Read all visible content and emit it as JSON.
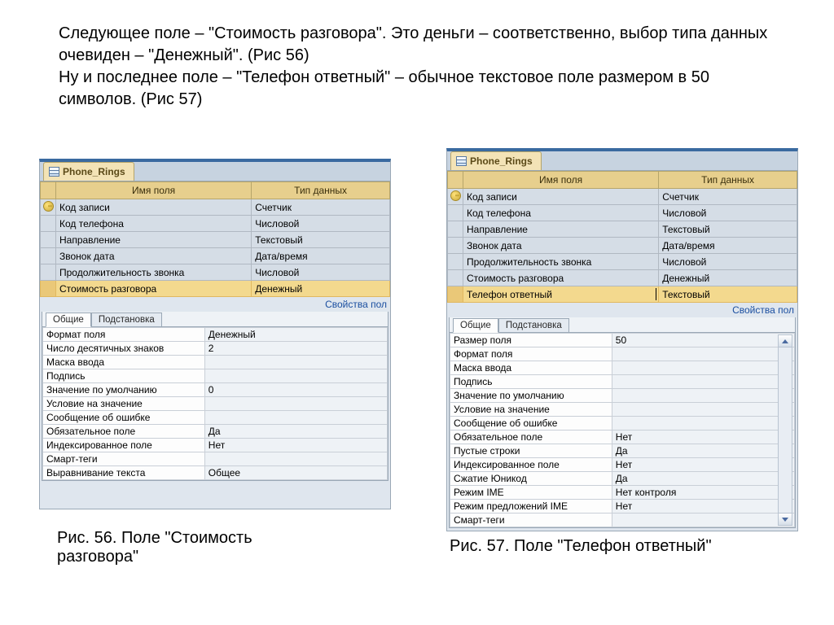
{
  "intro": {
    "p1_a": "Следующее поле – \"Стоимость разговора\". Это деньги – соответственно, выбор типа данных очевиден – \"Денежный\". (Рис 56)",
    "p2_a": "Ну и последнее поле – \"Телефон ответный\" – обычное текстовое поле размером в 50 символов. (Рис 57)"
  },
  "common": {
    "table_tab": "Phone_Rings",
    "col_name": "Имя поля",
    "col_type": "Тип данных",
    "propbar": "Свойства пол",
    "tab_general": "Общие",
    "tab_lookup": "Подстановка"
  },
  "fig56": {
    "rows": [
      {
        "name": "Код записи",
        "type": "Счетчик",
        "pk": true
      },
      {
        "name": "Код телефона",
        "type": "Числовой"
      },
      {
        "name": "Направление",
        "type": "Текстовый"
      },
      {
        "name": "Звонок дата",
        "type": "Дата/время"
      },
      {
        "name": "Продолжительность звонка",
        "type": "Числовой"
      },
      {
        "name": "Стоимость разговора",
        "type": "Денежный",
        "sel": true
      }
    ],
    "props": [
      {
        "label": "Формат поля",
        "value": "Денежный"
      },
      {
        "label": "Число десятичных знаков",
        "value": "2"
      },
      {
        "label": "Маска ввода",
        "value": ""
      },
      {
        "label": "Подпись",
        "value": ""
      },
      {
        "label": "Значение по умолчанию",
        "value": "0"
      },
      {
        "label": "Условие на значение",
        "value": ""
      },
      {
        "label": "Сообщение об ошибке",
        "value": ""
      },
      {
        "label": "Обязательное поле",
        "value": "Да"
      },
      {
        "label": "Индексированное поле",
        "value": "Нет"
      },
      {
        "label": "Смарт-теги",
        "value": ""
      },
      {
        "label": "Выравнивание текста",
        "value": "Общее"
      }
    ],
    "caption": "Рис. 56. Поле \"Стоимость разговора\""
  },
  "fig57": {
    "rows": [
      {
        "name": "Код записи",
        "type": "Счетчик",
        "pk": true
      },
      {
        "name": "Код телефона",
        "type": "Числовой"
      },
      {
        "name": "Направление",
        "type": "Текстовый"
      },
      {
        "name": "Звонок дата",
        "type": "Дата/время"
      },
      {
        "name": "Продолжительность звонка",
        "type": "Числовой"
      },
      {
        "name": "Стоимость разговора",
        "type": "Денежный"
      },
      {
        "name": "Телефон ответный",
        "type": "Текстовый",
        "sel": true,
        "cursor": true
      }
    ],
    "props": [
      {
        "label": "Размер поля",
        "value": "50"
      },
      {
        "label": "Формат поля",
        "value": ""
      },
      {
        "label": "Маска ввода",
        "value": ""
      },
      {
        "label": "Подпись",
        "value": ""
      },
      {
        "label": "Значение по умолчанию",
        "value": ""
      },
      {
        "label": "Условие на значение",
        "value": ""
      },
      {
        "label": "Сообщение об ошибке",
        "value": ""
      },
      {
        "label": "Обязательное поле",
        "value": "Нет"
      },
      {
        "label": "Пустые строки",
        "value": "Да"
      },
      {
        "label": "Индексированное поле",
        "value": "Нет"
      },
      {
        "label": "Сжатие Юникод",
        "value": "Да"
      },
      {
        "label": "Режим IME",
        "value": "Нет контроля"
      },
      {
        "label": "Режим предложений IME",
        "value": "Нет"
      },
      {
        "label": "Смарт-теги",
        "value": ""
      }
    ],
    "caption": "Рис. 57. Поле \"Телефон ответный\""
  }
}
